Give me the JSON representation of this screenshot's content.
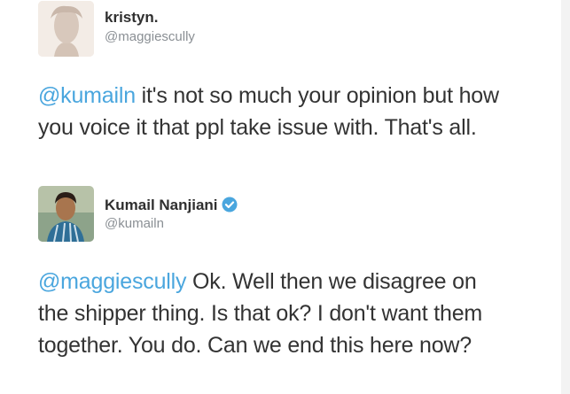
{
  "tweets": [
    {
      "display_name": "kristyn.",
      "handle": "@maggiescully",
      "mention": "@kumailn",
      "body": " it's not so much your opinion but how you voice it that ppl take issue with. That's all.",
      "avatar_icon": "user-avatar-photo",
      "verified": false
    },
    {
      "display_name": "Kumail Nanjiani",
      "handle": "@kumailn",
      "mention": "@maggiescully",
      "body": " Ok. Well then we disagree on the shipper thing. Is that ok? I don't want them together. You do. Can we end this here now?",
      "avatar_icon": "user-avatar-photo",
      "verified": true,
      "verified_icon": "verified-badge-icon"
    }
  ],
  "colors": {
    "mention": "#4aa6de",
    "verified": "#4aa6de",
    "handle": "#8a8f94",
    "text": "#333333"
  }
}
